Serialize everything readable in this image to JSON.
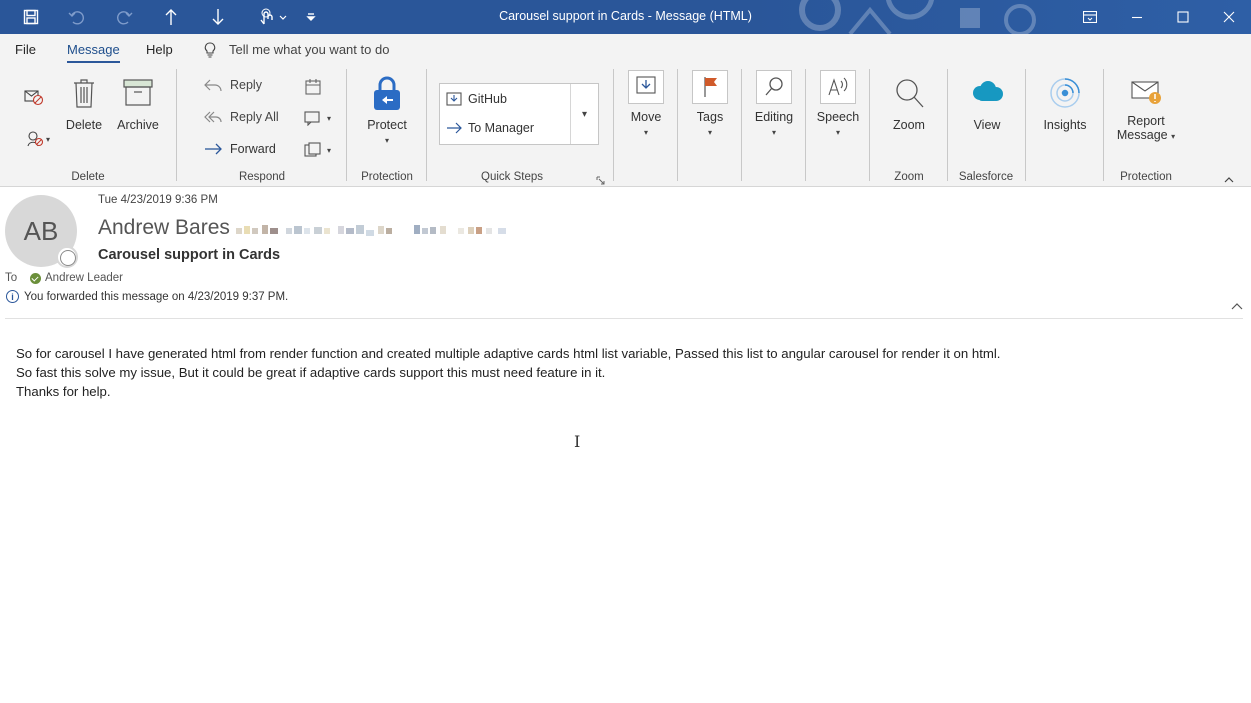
{
  "window": {
    "title": "Carousel support in Cards  -  Message (HTML)"
  },
  "quick_access": {
    "icons": [
      "save-icon",
      "undo-icon",
      "redo-icon",
      "previous-item-icon",
      "next-item-icon",
      "touch-mode-icon",
      "customize-qat-icon"
    ]
  },
  "menu": {
    "file": "File",
    "message": "Message",
    "help": "Help",
    "tell_me": "Tell me what you want to do"
  },
  "ribbon": {
    "delete_group": {
      "label": "Delete",
      "delete": "Delete",
      "archive": "Archive"
    },
    "respond_group": {
      "label": "Respond",
      "reply": "Reply",
      "reply_all": "Reply All",
      "forward": "Forward"
    },
    "protection_group": {
      "label": "Protection",
      "protect": "Protect"
    },
    "quick_steps_group": {
      "label": "Quick Steps",
      "github": "GitHub",
      "to_manager": "To Manager"
    },
    "move": "Move",
    "tags": "Tags",
    "editing": "Editing",
    "speech": "Speech",
    "zoom_group": {
      "label": "Zoom",
      "zoom": "Zoom"
    },
    "salesforce_group": {
      "label": "Salesforce",
      "view": "View"
    },
    "insights": "Insights",
    "protection2_group": {
      "label": "Protection",
      "report_line1": "Report",
      "report_line2": "Message"
    }
  },
  "message": {
    "avatar_initials": "AB",
    "date": "Tue 4/23/2019 9:36 PM",
    "sender": "Andrew Bares",
    "subject": "Carousel support in Cards",
    "to_label": "To",
    "to_name": "Andrew Leader",
    "info": "You forwarded this message on 4/23/2019 9:37 PM.",
    "body": [
      "So for carousel I have generated html from render function and created multiple adaptive cards html list variable, Passed this list to angular carousel for render it on html.",
      "So fast this solve my issue, But it could be great if adaptive cards support this must need feature in it.",
      "Thanks for help."
    ]
  },
  "colors": {
    "titlebar": "#2a5699",
    "ribbon_bg": "#f3f3f3",
    "accent": "#2b579a",
    "salesforce": "#1798c1"
  }
}
